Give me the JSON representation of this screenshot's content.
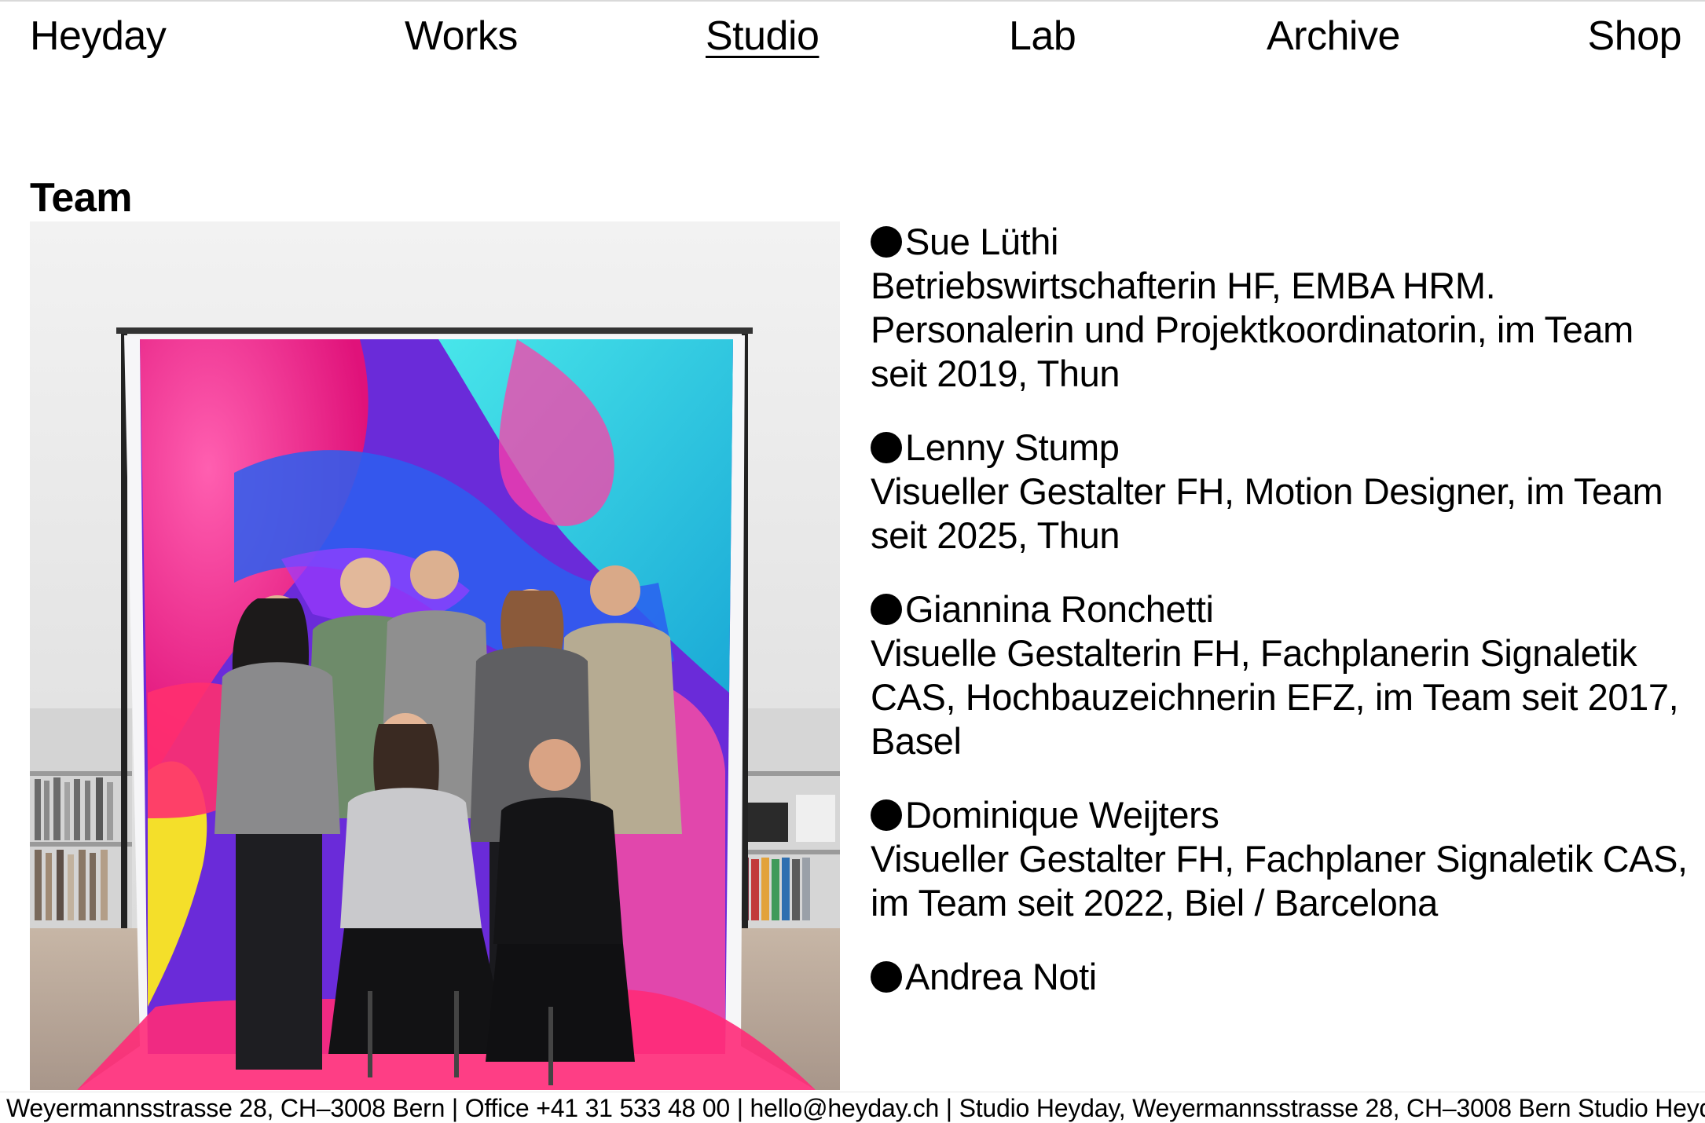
{
  "nav": {
    "logo": "Heyday",
    "items": [
      {
        "label": "Works",
        "active": false
      },
      {
        "label": "Studio",
        "active": true
      },
      {
        "label": "Lab",
        "active": false
      },
      {
        "label": "Archive",
        "active": false
      },
      {
        "label": "Shop",
        "active": false
      }
    ]
  },
  "section": {
    "title": "Team"
  },
  "photo": {
    "icon": "team-group-photo",
    "colors": {
      "backdrop_pink": "#f0328f",
      "backdrop_cyan": "#2fd3dc",
      "backdrop_purple": "#6a2bd9",
      "backdrop_blue": "#2a5ff0",
      "backdrop_yellow": "#f4df2a",
      "wall": "#ececec",
      "floor": "#b9a89a"
    }
  },
  "team": [
    {
      "name": "Sue Lüthi",
      "bio": "Betriebswirtschafterin HF, EMBA HRM. Personalerin und Projektkoordinatorin, im Team seit 2019, Thun"
    },
    {
      "name": "Lenny Stump",
      "bio": "Visueller Gestalter FH, Motion Designer, im Team seit 2025, Thun"
    },
    {
      "name": "Giannina Ronchetti",
      "bio": "Visuelle Gestalterin FH, Fachplanerin Signaletik CAS, Hochbauzeichnerin EFZ, im Team seit 2017, Basel"
    },
    {
      "name": "Dominique Weijters",
      "bio": "Visueller Gestalter FH, Fachplaner Signaletik CAS, im Team seit 2022, Biel / Barcelona"
    },
    {
      "name": "Andrea Noti",
      "bio": ""
    }
  ],
  "footer": {
    "ticker": "Weyermannsstrasse 28, CH–3008 Bern | Office +41 31 533 48 00 | hello@heyday.ch | Studio Heyday, Weyermannsstrasse 28, CH–3008 Bern  Studio Heyday"
  }
}
